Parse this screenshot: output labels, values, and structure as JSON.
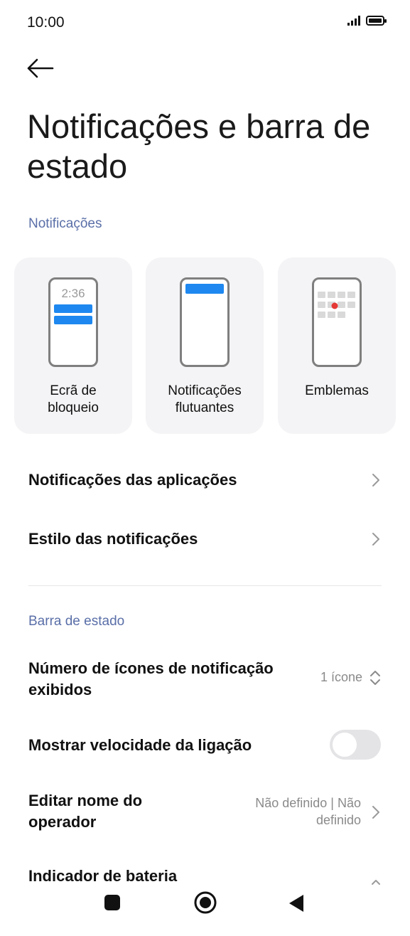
{
  "status_bar": {
    "time": "10:00"
  },
  "header": {
    "title": "Notificações e barra de estado"
  },
  "notifications_section": {
    "label": "Notificações",
    "cards": [
      {
        "label": "Ecrã de\nbloqueio",
        "preview_time": "2:36"
      },
      {
        "label": "Notificações\nflutuantes"
      },
      {
        "label": "Emblemas"
      }
    ],
    "rows": [
      {
        "title": "Notificações das aplicações"
      },
      {
        "title": "Estilo das notificações"
      }
    ]
  },
  "status_bar_section": {
    "label": "Barra de estado",
    "icon_count": {
      "title": "Número de ícones de notificação exibidos",
      "value": "1 ícone"
    },
    "speed": {
      "title": "Mostrar velocidade da ligação",
      "enabled": false
    },
    "operator": {
      "title": "Editar nome do operador",
      "value": "Não definido | Não definido"
    },
    "battery": {
      "title": "Indicador de bateria"
    }
  },
  "colors": {
    "accent": "#1e88f0",
    "section": "#5a6fa8",
    "badge": "#e53935"
  }
}
